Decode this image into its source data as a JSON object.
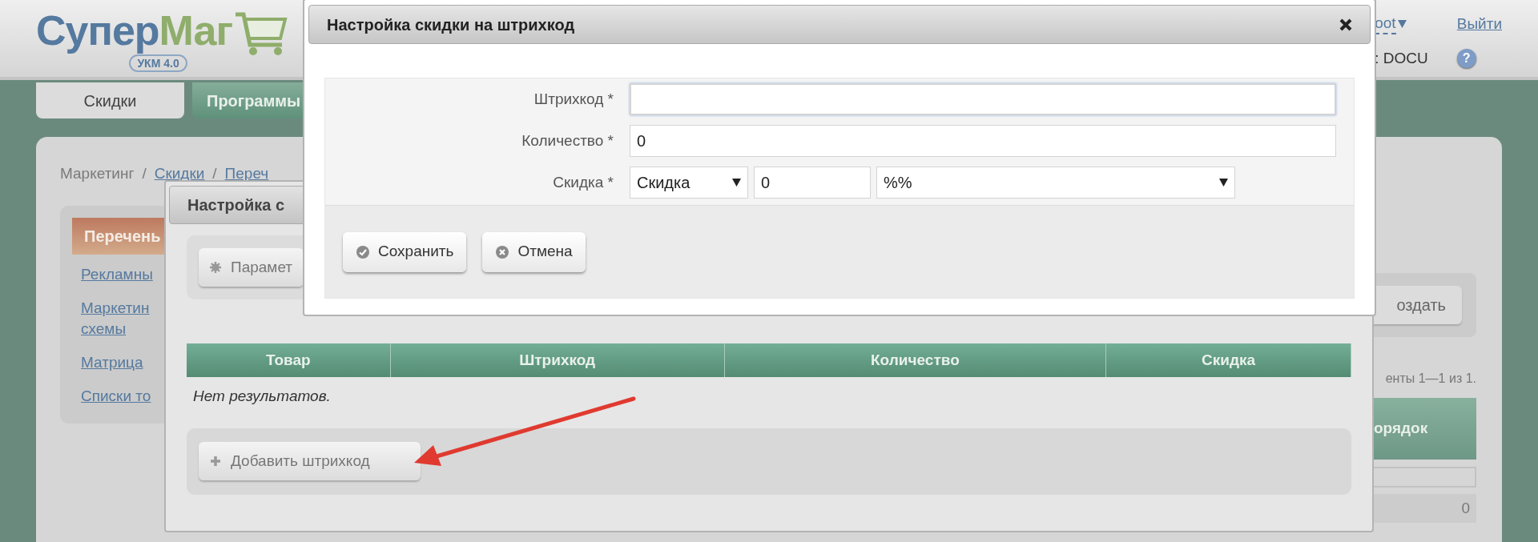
{
  "header": {
    "logo": {
      "parts": [
        "Супер",
        "Маг"
      ],
      "badge": "УКМ 4.0"
    },
    "user": "oot",
    "logout": "Выйти",
    "shop": ": DOCU",
    "help": "?"
  },
  "tabs": [
    {
      "label": "Скидки",
      "selected": true
    },
    {
      "label": "Программы",
      "selected": false
    }
  ],
  "breadcrumb": [
    {
      "kind": "text",
      "label": "Маркетинг"
    },
    {
      "kind": "separator",
      "label": "/"
    },
    {
      "kind": "link",
      "label": "Скидки"
    },
    {
      "kind": "separator",
      "label": "/"
    },
    {
      "kind": "link",
      "label": "Переч"
    }
  ],
  "sidebar": {
    "title": "Перечень",
    "links": [
      "Рекламны",
      "Маркетин\nсхемы",
      "Матрица",
      "Списки то"
    ]
  },
  "list_behind": {
    "create_button": "оздать",
    "pager": "енты 1—1 из 1.",
    "column": "орядок",
    "row_value": "0"
  },
  "dialog_back": {
    "title": "Настройка с",
    "params_button": "Парамет",
    "columns": [
      "Товар",
      "Штрихкод",
      "Количество",
      "Скидка"
    ],
    "empty": "Нет результатов.",
    "add_button": "Добавить штрихкод"
  },
  "dialog_front": {
    "title": "Настройка скидки на штрихкод",
    "fields": [
      {
        "kind": "text",
        "label": "Штрихкод *",
        "focused": true
      },
      {
        "kind": "text",
        "label": "Количество *",
        "value": "0",
        "focused": false
      },
      {
        "kind": "combo",
        "label": "Скидка *",
        "type_value": "Скидка",
        "amount": "0",
        "unit": "%%"
      }
    ],
    "buttons": [
      {
        "kind": "save",
        "label": "Сохранить"
      },
      {
        "kind": "cancel",
        "label": "Отмена"
      }
    ]
  }
}
